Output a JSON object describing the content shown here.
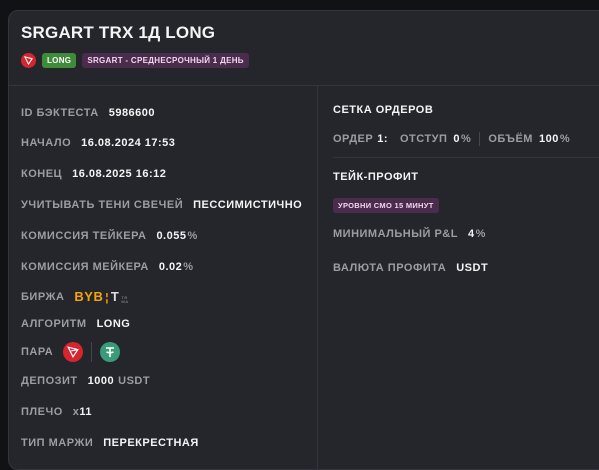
{
  "header": {
    "title": "SRGART TRX 1Д LONG",
    "tag_long": "LONG",
    "tag_strategy": "SRGART - СРЕДНЕСРОЧНЫЙ 1 ДЕНЬ"
  },
  "left": {
    "id_label": "ID БЭКТЕСТА",
    "id_value": "5986600",
    "start_label": "НАЧАЛО",
    "start_value": "16.08.2024 17:53",
    "end_label": "КОНЕЦ",
    "end_value": "16.08.2025 16:12",
    "shadows_label": "УЧИТЫВАТЬ ТЕНИ СВЕЧЕЙ",
    "shadows_value": "ПЕССИМИСТИЧНО",
    "taker_label": "КОМИССИЯ ТЕЙКЕРА",
    "taker_value": "0.055",
    "taker_unit": "%",
    "maker_label": "КОМИССИЯ МЕЙКЕРА",
    "maker_value": "0.02",
    "maker_unit": "%",
    "exchange_label": "БИРЖА",
    "exchange_logo": "BYBIT",
    "algo_label": "АЛГОРИТМ",
    "algo_value": "LONG",
    "pair_label": "ПАРА",
    "deposit_label": "ДЕПОЗИТ",
    "deposit_value": "1000",
    "deposit_unit": "USDT",
    "leverage_label": "ПЛЕЧО",
    "leverage_prefix": "x",
    "leverage_value": "11",
    "margin_label": "ТИП МАРЖИ",
    "margin_value": "ПЕРЕКРЕСТНАЯ"
  },
  "right": {
    "grid_title": "СЕТКА ОРДЕРОВ",
    "order_label": "ОРДЕР",
    "order_value": "1:",
    "offset_label": "ОТСТУП",
    "offset_value": "0",
    "offset_unit": "%",
    "volume_label": "ОБЪЁМ",
    "volume_value": "100",
    "volume_unit": "%",
    "tp_title": "ТЕЙК-ПРОФИТ",
    "tp_tag": "УРОВНИ СМО 15 МИНУТ",
    "minpl_label": "МИНИМАЛЬНЫЙ P&L",
    "minpl_value": "4",
    "minpl_unit": "%",
    "profit_currency_label": "ВАЛЮТА ПРОФИТА",
    "profit_currency_value": "USDT"
  },
  "colors": {
    "accent_long": "#3e8c3a",
    "strategy_tag": "#4a2c4c",
    "trx": "#d8242f",
    "usdt": "#3a9b7a",
    "bybit": "#f7a600"
  },
  "icons": {
    "trx": "tron-icon",
    "usdt": "tether-icon"
  }
}
